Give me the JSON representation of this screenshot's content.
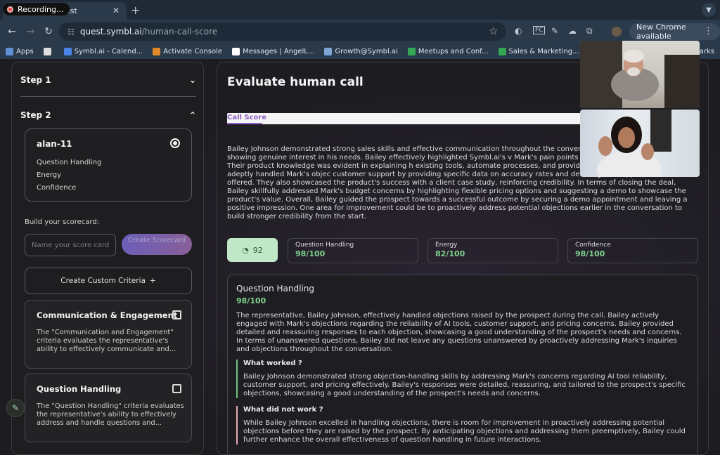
{
  "browser": {
    "recording_label": "Recording...",
    "tab_title": "uest",
    "url_host": "quest.symbl.ai",
    "url_path": "/human-call-score",
    "new_chrome": "New Chrome available",
    "bookmarks": [
      {
        "label": "Apps",
        "color": "#5f8fd4"
      },
      {
        "label": "",
        "color": "#dddddd"
      },
      {
        "label": "Symbl.ai - Calend...",
        "color": "#4a86e8"
      },
      {
        "label": "Activate Console",
        "color": "#e08a2c"
      },
      {
        "label": "Messages | AngelL...",
        "color": "#ffffff"
      },
      {
        "label": "Growth@Symbl.ai",
        "color": "#7aa6d8"
      },
      {
        "label": "Meetups and Conf...",
        "color": "#34a853"
      },
      {
        "label": "Sales & Marketing...",
        "color": "#34a853"
      },
      {
        "label": "Microsoft Word - E...",
        "color": "#dddddd"
      }
    ],
    "bookmarks_more": "arks"
  },
  "sidebar": {
    "step1": "Step 1",
    "step2": "Step 2",
    "selected_card": {
      "title": "alan-11",
      "criteria": [
        "Question Handling",
        "Energy",
        "Confidence"
      ]
    },
    "build_label": "Build your scorecard:",
    "score_placeholder": "Name your score card",
    "create_label": "Create Scorecard",
    "custom_criteria_label": "Create Custom Criteria",
    "criteria_cards": [
      {
        "title": "Communication & Engagement",
        "desc": "The \"Communication and Engagement\" criteria evaluates the representative's ability to effectively communicate and..."
      },
      {
        "title": "Question Handling",
        "desc": "The \"Question Handling\" criteria evaluates the representative's ability to effectively address and handle questions and..."
      }
    ]
  },
  "main": {
    "title": "Evaluate human call",
    "tab_label": "Call Score",
    "summary": "Bailey Johnson demonstrated strong sales skills and effective communication throughout the conversa rapport with Mark and showing genuine interest in his needs. Bailey effectively highlighted Symbl.ai's v Mark's pain points and offering tailored solutions. Their product knowledge was evident in explaining h existing tools, automate processes, and provide accurate insights. Bailey adeptly handled Mark's objec customer support by providing specific data on accuracy rates and detailing the support services offered. They also showcased the product's success with a client case study, reinforcing credibility. In terms of closing the deal, Bailey skillfully addressed Mark's budget concerns by highlighting flexible pricing options and suggesting a demo to showcase the product's value. Overall, Bailey guided the prospect towards a successful outcome by securing a demo appointment and leaving a positive impression. One area for improvement could be to proactively address potential objections earlier in the conversation to build stronger credibility from the start.",
    "overall_score": "92",
    "metrics": [
      {
        "name": "Question Handling",
        "value": "98/100"
      },
      {
        "name": "Energy",
        "value": "82/100"
      },
      {
        "name": "Confidence",
        "value": "98/100"
      }
    ],
    "detail": {
      "heading": "Question Handling",
      "score": "98/100",
      "body": "The representative, Bailey Johnson, effectively handled objections raised by the prospect during the call. Bailey actively engaged with Mark's objections regarding the reliability of AI tools, customer support, and pricing concerns. Bailey provided detailed and reassuring responses to each objection, showcasing a good understanding of the prospect's needs and concerns. In terms of unanswered questions, Bailey did not leave any questions unanswered by proactively addressing Mark's inquiries and objections throughout the conversation.",
      "worked_heading": "What worked ?",
      "worked_body": "Bailey Johnson demonstrated strong objection-handling skills by addressing Mark's concerns regarding AI tool reliability, customer support, and pricing effectively. Bailey's responses were detailed, reassuring, and tailored to the prospect's specific objections, showcasing a good understanding of the prospect's needs and concerns.",
      "notwork_heading": "What did not work ?",
      "notwork_body": "While Bailey Johnson excelled in handling objections, there is room for improvement in proactively addressing potential objections before they are raised by the prospect. By anticipating objections and addressing them preemptively, Bailey could further enhance the overall effectiveness of question handling in future interactions."
    }
  },
  "colors": {
    "accent": "#8e5fc4",
    "score_green": "#7fd38e"
  }
}
